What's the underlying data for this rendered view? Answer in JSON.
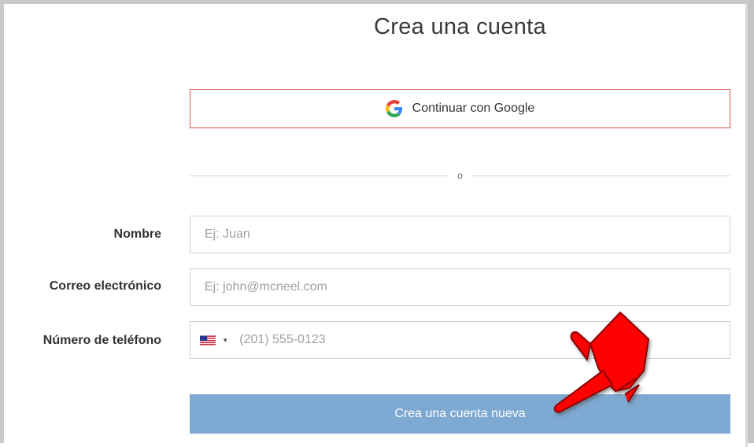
{
  "page": {
    "title": "Crea una cuenta"
  },
  "google": {
    "label": "Continuar con Google"
  },
  "divider": {
    "text": "o"
  },
  "form": {
    "name": {
      "label": "Nombre",
      "placeholder": "Ej: Juan",
      "value": ""
    },
    "email": {
      "label": "Correo electrónico",
      "placeholder": "Ej: john@mcneel.com",
      "value": ""
    },
    "phone": {
      "label": "Número de teléfono",
      "placeholder": "(201) 555-0123",
      "value": "",
      "country_icon": "us-flag-icon"
    }
  },
  "submit": {
    "label": "Crea una cuenta nueva",
    "color": "#7ea9d2"
  },
  "annotation": {
    "icon": "red-hand-pointer-icon",
    "color": "#ff0000"
  }
}
